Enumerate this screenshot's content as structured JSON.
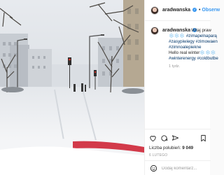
{
  "post": {
    "username": "aradwanska",
    "follow_sep": "•",
    "follow_label": "Obserw",
    "caption_lines": [
      {
        "text": "Witaj praw",
        "kind": "text"
      },
      {
        "text": "❄️❄️❄️ #zimapelnaparą",
        "kind": "tag"
      },
      {
        "text": "#zasypiwiegy #zimowaen",
        "kind": "tag"
      },
      {
        "text": "#zimnoalepiekne",
        "kind": "tag"
      },
      {
        "text": "Hello real winter❄️❄️❄️",
        "kind": "text"
      },
      {
        "text": "#winterenergy #coldbutbe",
        "kind": "tag"
      }
    ],
    "timeago": "1 tydz.",
    "likes_label": "Liczba polubień:",
    "likes_count": "9 049",
    "date": "6 LUTEGO",
    "comment_placeholder": "Dodaj komentarz..."
  },
  "icons": {
    "like": "heart-icon",
    "comment": "comment-icon",
    "share": "share-icon",
    "save": "bookmark-icon",
    "emoji": "emoji-icon"
  },
  "colors": {
    "link_blue": "#3897f0",
    "hashtag_navy": "#003569",
    "text": "#262626",
    "muted": "#999999",
    "border": "#efefef"
  }
}
